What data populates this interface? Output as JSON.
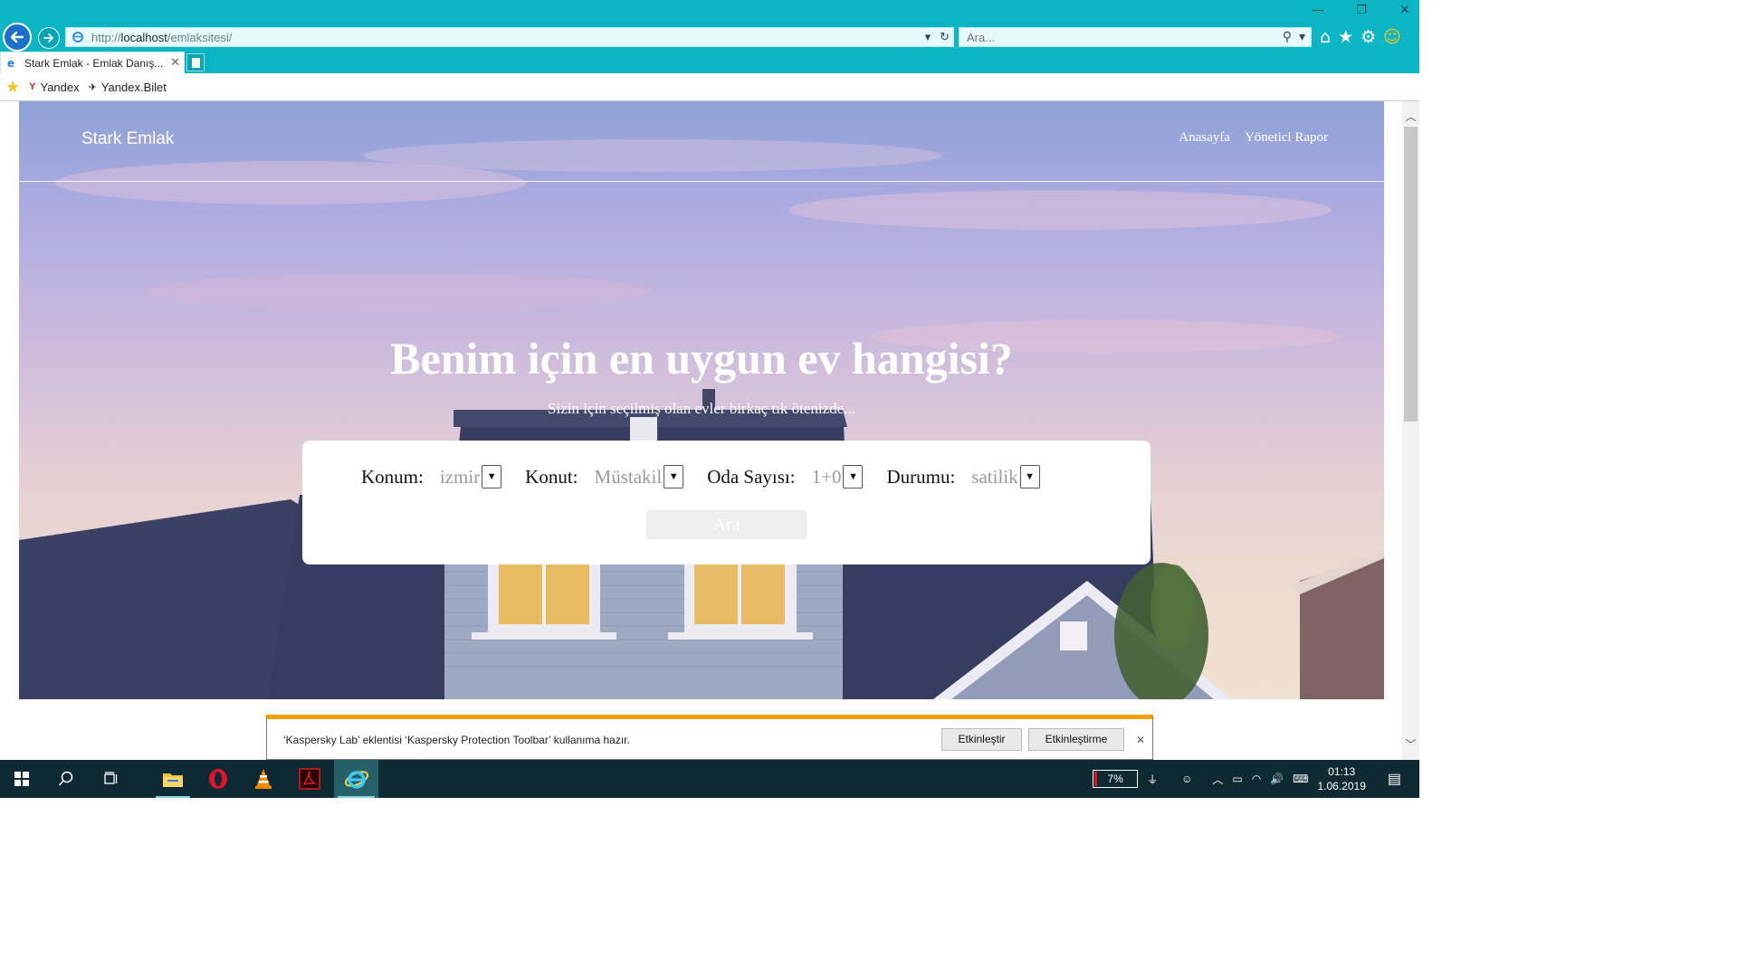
{
  "browser": {
    "address_url_prefix": "http://",
    "address_url_host": "localhost",
    "address_url_path": "/emlaksitesi/",
    "search_placeholder": "Ara...",
    "tab_title": "Stark Emlak - Emlak Danış...",
    "favorites": [
      {
        "label": "Yandex",
        "icon": "yandex-icon"
      },
      {
        "label": "Yandex.Bilet",
        "icon": "plane-icon"
      }
    ]
  },
  "site": {
    "brand": "Stark Emlak",
    "menu": [
      "Anasayfa",
      "Yönetici Rapor"
    ],
    "headline": "Benim için en uygun ev hangisi?",
    "subline": "Sizin için seçilmiş olan evler birkaç tık ötenizde...",
    "filters": [
      {
        "label": "Konum:",
        "value": "izmir"
      },
      {
        "label": "Konut:",
        "value": "Müstakil"
      },
      {
        "label": "Oda Sayısı:",
        "value": "1+0"
      },
      {
        "label": "Durumu:",
        "value": "satilik"
      }
    ],
    "search_button": "Ara"
  },
  "notification": {
    "message": "‘Kaspersky Lab’ eklentisi ‘Kaspersky Protection Toolbar’ kullanıma hazır.",
    "enable_button": "Etkinleştir",
    "disable_button": "Etkinleştirme"
  },
  "taskbar": {
    "battery_percent": "7%",
    "time": "01:13",
    "date": "1.06.2019"
  },
  "colors": {
    "chrome": "#0bb5c3",
    "taskbar": "#0f2a33",
    "notification_accent": "#f0a100"
  }
}
